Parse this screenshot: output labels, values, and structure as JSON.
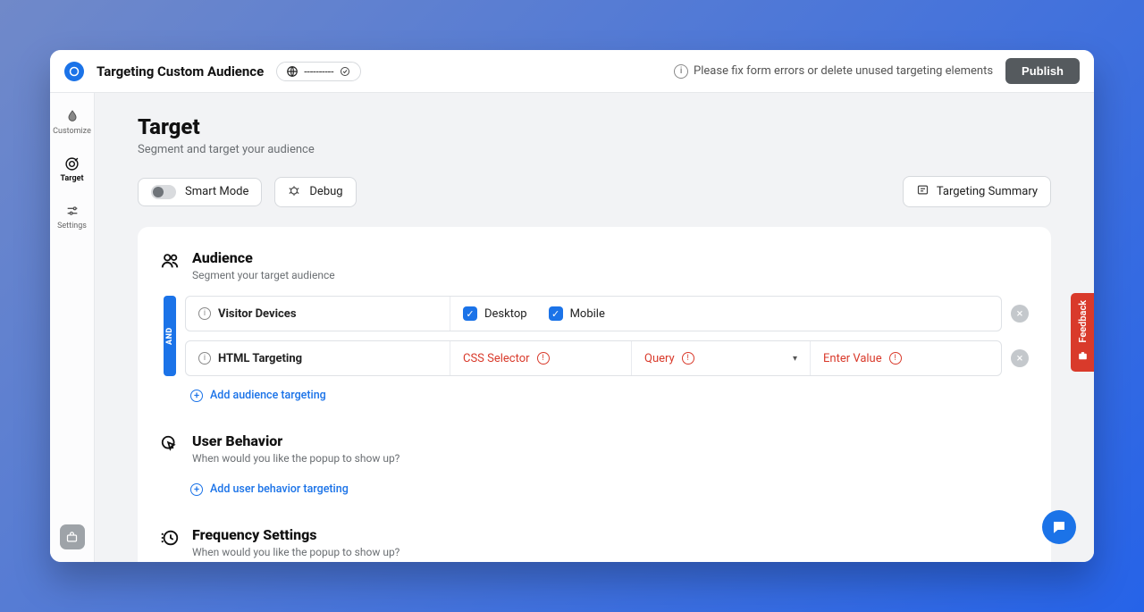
{
  "header": {
    "title": "Targeting Custom Audience",
    "status_chip": "----------",
    "error_message": "Please fix form errors or delete unused targeting elements",
    "publish_label": "Publish"
  },
  "sidebar": {
    "items": [
      {
        "label": "Customize"
      },
      {
        "label": "Target"
      },
      {
        "label": "Settings"
      }
    ]
  },
  "page": {
    "title": "Target",
    "subtitle": "Segment and target your audience"
  },
  "controls": {
    "smart_mode_label": "Smart Mode",
    "debug_label": "Debug",
    "summary_label": "Targeting Summary"
  },
  "audience": {
    "title": "Audience",
    "subtitle": "Segment your target audience",
    "connector": "AND",
    "rule1": {
      "label": "Visitor Devices",
      "option1": "Desktop",
      "option2": "Mobile"
    },
    "rule2": {
      "label": "HTML Targeting",
      "field1": "CSS Selector",
      "field2": "Query",
      "field3": "Enter Value"
    },
    "add_label": "Add audience targeting"
  },
  "behavior": {
    "title": "User Behavior",
    "subtitle": "When would you like the popup to show up?",
    "add_label": "Add user behavior targeting"
  },
  "frequency": {
    "title": "Frequency Settings",
    "subtitle": "When would you like the popup to show up?"
  },
  "feedback": {
    "label": "Feedback"
  }
}
